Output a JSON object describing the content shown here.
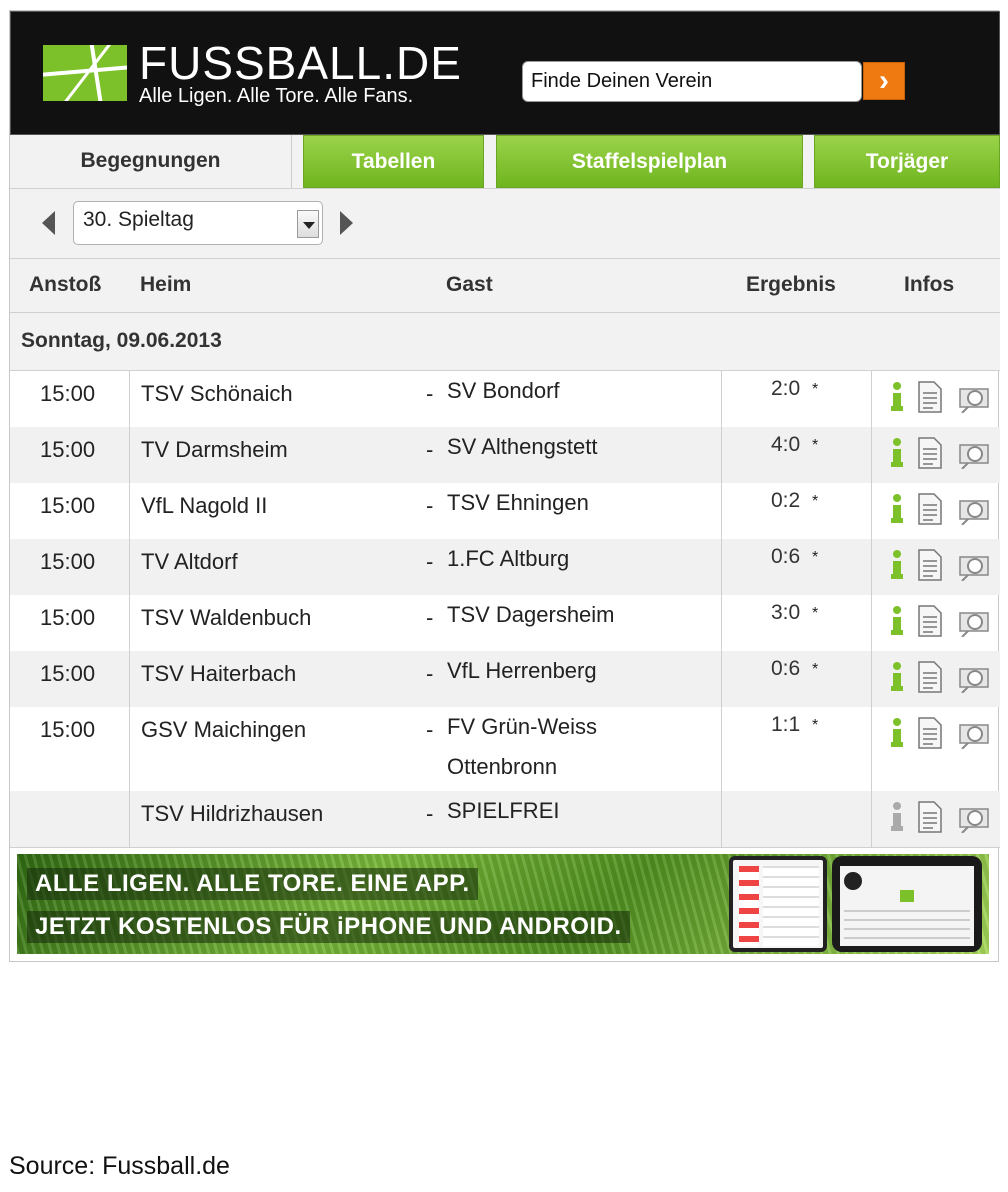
{
  "header": {
    "brand": "FUSSBALL.DE",
    "tagline": "Alle Ligen. Alle Tore. Alle Fans.",
    "search_placeholder": "Finde Deinen Verein",
    "search_button": "›"
  },
  "tabs": [
    {
      "label": "Begegnungen",
      "active": true
    },
    {
      "label": "Tabellen",
      "active": false
    },
    {
      "label": "Staffelspielplan",
      "active": false
    },
    {
      "label": "Torjäger",
      "active": false
    }
  ],
  "round_select": {
    "value": "30. Spieltag"
  },
  "columns": {
    "kickoff": "Anstoß",
    "home": "Heim",
    "guest": "Gast",
    "result": "Ergebnis",
    "info": "Infos"
  },
  "day": "Sonntag, 09.06.2013",
  "matches": [
    {
      "time": "15:00",
      "home": "TSV Schönaich",
      "guest": "SV Bondorf",
      "result": "2:0",
      "star": "*",
      "active": true
    },
    {
      "time": "15:00",
      "home": "TV Darmsheim",
      "guest": "SV Althengstett",
      "result": "4:0",
      "star": "*",
      "active": true
    },
    {
      "time": "15:00",
      "home": "VfL Nagold II",
      "guest": "TSV Ehningen",
      "result": "0:2",
      "star": "*",
      "active": true
    },
    {
      "time": "15:00",
      "home": "TV Altdorf",
      "guest": "1.FC Altburg",
      "result": "0:6",
      "star": "*",
      "active": true
    },
    {
      "time": "15:00",
      "home": "TSV Waldenbuch",
      "guest": "TSV Dagersheim",
      "result": "3:0",
      "star": "*",
      "active": true
    },
    {
      "time": "15:00",
      "home": "TSV Haiterbach",
      "guest": "VfL Herrenberg",
      "result": "0:6",
      "star": "*",
      "active": true
    },
    {
      "time": "15:00",
      "home": "GSV Maichingen",
      "guest": "FV Grün-Weiss Ottenbronn",
      "result": "1:1",
      "star": "*",
      "active": true
    },
    {
      "time": "",
      "home": "TSV Hildrizhausen",
      "guest": "SPIELFREI",
      "result": "",
      "star": "",
      "active": false
    }
  ],
  "dash": "-",
  "banner": {
    "line1": "ALLE LIGEN. ALLE TORE. EINE APP.",
    "line2": "JETZT KOSTENLOS FÜR iPHONE UND ANDROID."
  },
  "source": "Source: Fussball.de",
  "colors": {
    "accent_green": "#7cc12a",
    "search_orange": "#f07a12",
    "header_bg": "#111111"
  },
  "icons": [
    "info-icon",
    "document-icon",
    "camera-icon"
  ]
}
